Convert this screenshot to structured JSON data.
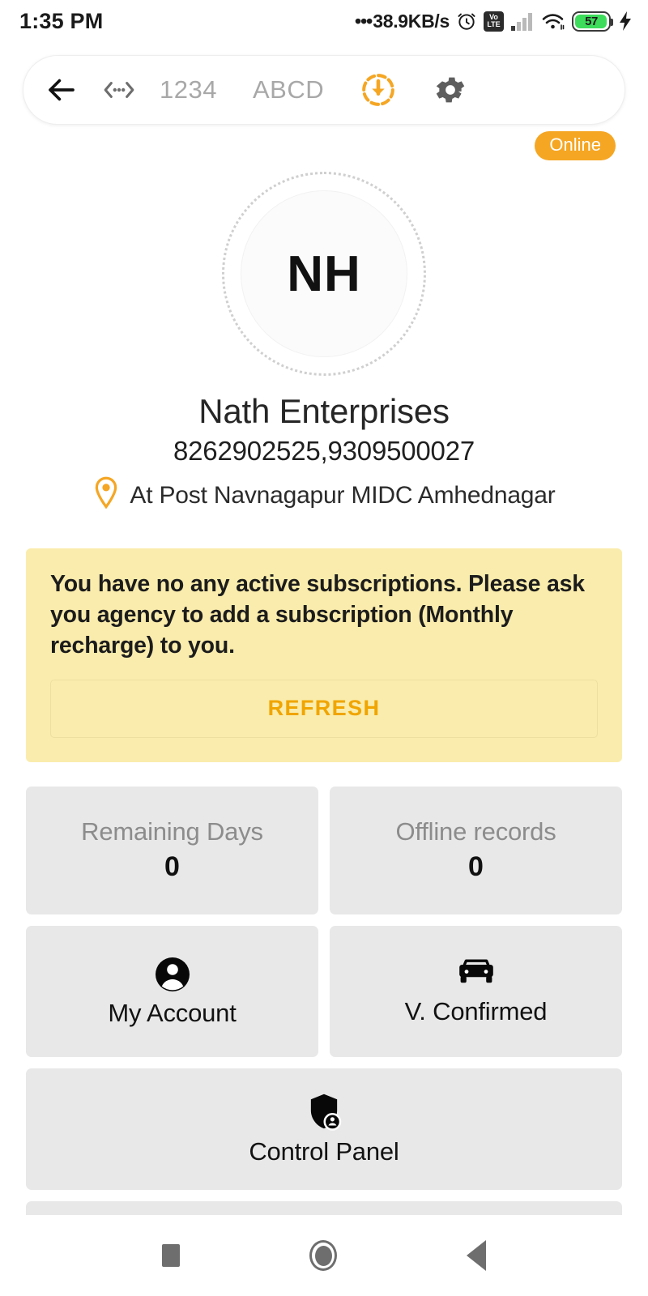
{
  "status_bar": {
    "time": "1:35 PM",
    "dots": "•••",
    "net_speed": "38.9KB/s",
    "alarm_icon": "alarm-clock-icon",
    "volte_top": "Vo",
    "volte_bottom": "LTE",
    "signal_icon": "cellular-signal-icon",
    "wifi_icon": "wifi-icon",
    "battery_level": "57",
    "charging_icon": "charging-bolt-icon"
  },
  "toolbar": {
    "back_icon": "back-arrow-icon",
    "code_icon": "code-brackets-icon",
    "field_numeric": "1234",
    "field_alpha": "ABCD",
    "download_icon": "download-circle-icon",
    "settings_icon": "gear-icon",
    "accent_color": "#f5a623"
  },
  "status_badge": {
    "label": "Online",
    "color": "#f5a623"
  },
  "profile": {
    "initials": "NH",
    "name": "Nath Enterprises",
    "phones": "8262902525,9309500027",
    "location_icon": "location-pin-icon",
    "address": "At Post Navnagapur MIDC Amhednagar"
  },
  "alert": {
    "message": "You have no any active subscriptions. Please ask you agency to add a subscription (Monthly recharge) to you.",
    "refresh_label": "REFRESH",
    "background_color": "#faecac",
    "action_color": "#f0a500"
  },
  "stats": [
    {
      "label": "Remaining Days",
      "value": "0"
    },
    {
      "label": "Offline records",
      "value": "0"
    }
  ],
  "actions": [
    {
      "label": "My Account",
      "icon": "account-circle-icon"
    },
    {
      "label": "V. Confirmed",
      "icon": "car-icon"
    },
    {
      "label": "Control Panel",
      "icon": "admin-shield-icon"
    }
  ],
  "nav_bar": {
    "recents_icon": "recents-square-icon",
    "home_icon": "home-circle-icon",
    "back_icon": "back-triangle-icon"
  }
}
